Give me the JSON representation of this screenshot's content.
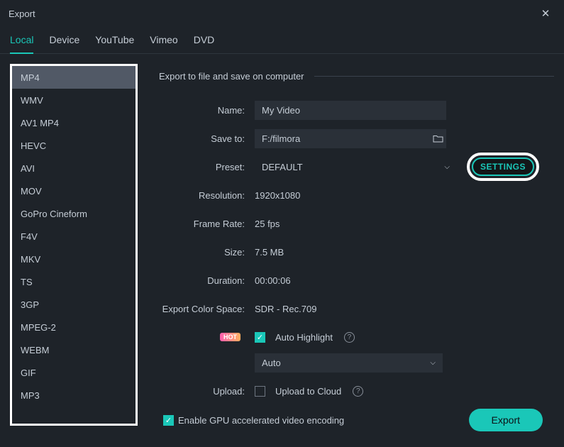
{
  "window": {
    "title": "Export"
  },
  "tabs": [
    {
      "label": "Local",
      "active": true
    },
    {
      "label": "Device",
      "active": false
    },
    {
      "label": "YouTube",
      "active": false
    },
    {
      "label": "Vimeo",
      "active": false
    },
    {
      "label": "DVD",
      "active": false
    }
  ],
  "formats": [
    "MP4",
    "WMV",
    "AV1 MP4",
    "HEVC",
    "AVI",
    "MOV",
    "GoPro Cineform",
    "F4V",
    "MKV",
    "TS",
    "3GP",
    "MPEG-2",
    "WEBM",
    "GIF",
    "MP3"
  ],
  "selected_format_index": 0,
  "section_header": "Export to file and save on computer",
  "fields": {
    "name": {
      "label": "Name:",
      "value": "My Video"
    },
    "save_to": {
      "label": "Save to:",
      "value": "F:/filmora"
    },
    "preset": {
      "label": "Preset:",
      "value": "DEFAULT"
    },
    "settings_btn": "SETTINGS",
    "resolution": {
      "label": "Resolution:",
      "value": "1920x1080"
    },
    "frame_rate": {
      "label": "Frame Rate:",
      "value": "25 fps"
    },
    "size": {
      "label": "Size:",
      "value": "7.5 MB"
    },
    "duration": {
      "label": "Duration:",
      "value": "00:00:06"
    },
    "color_space": {
      "label": "Export Color Space:",
      "value": "SDR - Rec.709"
    },
    "hot_badge": "HOT",
    "auto_highlight": {
      "label": "Auto Highlight",
      "checked": true
    },
    "auto_dropdown": "Auto",
    "upload": {
      "label": "Upload:",
      "option": "Upload to Cloud",
      "checked": false
    }
  },
  "footer": {
    "gpu_label": "Enable GPU accelerated video encoding",
    "gpu_checked": true,
    "export_btn": "Export"
  }
}
